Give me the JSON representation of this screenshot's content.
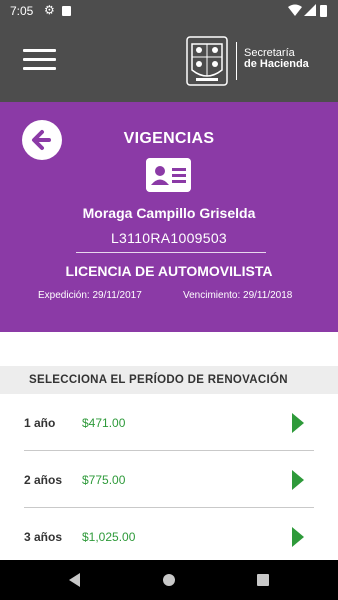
{
  "status_bar": {
    "time": "7:05",
    "icons": [
      "gear-icon",
      "sd-card-icon",
      "wifi-icon",
      "signal-icon",
      "battery-icon"
    ]
  },
  "app_bar": {
    "menu_icon": "hamburger-menu-icon",
    "logo": {
      "line1": "Secretaría",
      "line2": "de Hacienda"
    }
  },
  "header": {
    "title": "VIGENCIAS",
    "holder_name": "Moraga Campillo Griselda",
    "license_number": "L3110RA1009503",
    "license_type": "LICENCIA DE AUTOMOVILISTA",
    "issued": "Expedición: 29/11/2017",
    "expires": "Vencimiento: 29/11/2018",
    "background_color": "#8b3aa6"
  },
  "renewal": {
    "section_title": "SELECCIONA EL PERÍODO DE RENOVACIÓN",
    "options": [
      {
        "label": "1 año",
        "price": "$471.00"
      },
      {
        "label": "2 años",
        "price": "$775.00"
      },
      {
        "label": "3 años",
        "price": "$1,025.00"
      }
    ],
    "accent_color": "#2e9a3a"
  },
  "nav_bar": {
    "icons": [
      "back-triangle-icon",
      "home-circle-icon",
      "recents-square-icon"
    ]
  }
}
